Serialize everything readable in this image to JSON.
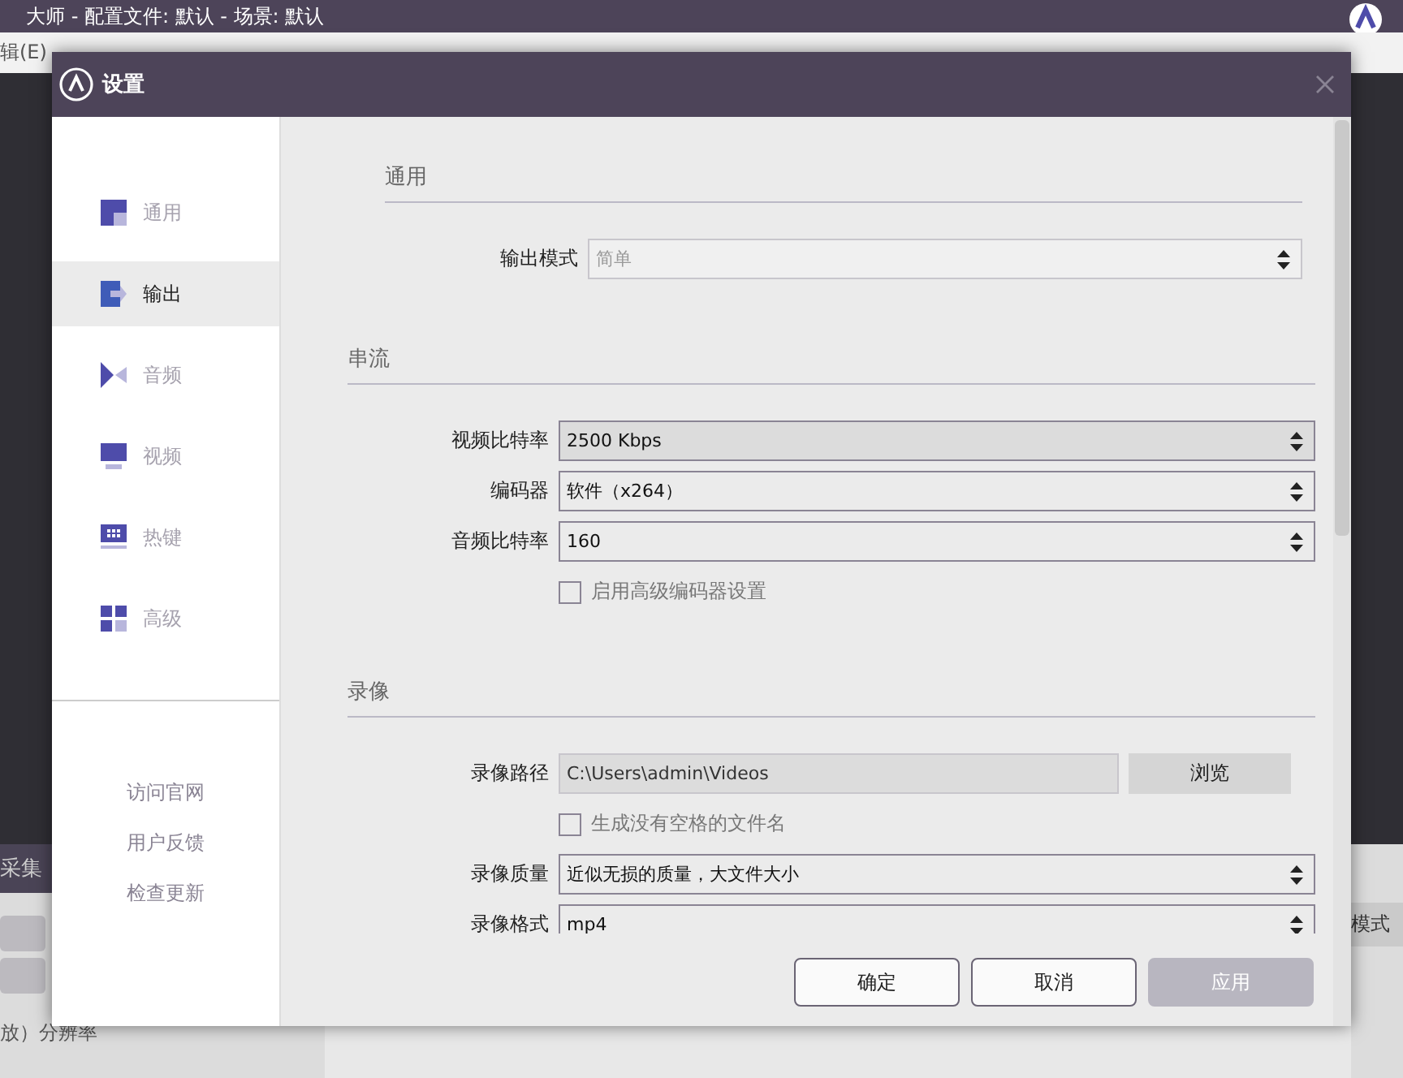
{
  "background_app": {
    "title": "大师  - 配置文件: 默认 - 场景: 默认",
    "menu": [
      "辑(E)"
    ],
    "dock_title": "采集",
    "mode_button": "模式",
    "resolution_label": "放）分辨率"
  },
  "dialog": {
    "title": "设置",
    "sidebar": {
      "items": [
        {
          "label": "通用",
          "selected": false
        },
        {
          "label": "输出",
          "selected": true
        },
        {
          "label": "音频",
          "selected": false
        },
        {
          "label": "视频",
          "selected": false
        },
        {
          "label": "热键",
          "selected": false
        },
        {
          "label": "高级",
          "selected": false
        }
      ],
      "links": [
        "访问官网",
        "用户反馈",
        "检查更新"
      ]
    },
    "sections": [
      {
        "title": "通用",
        "rows": [
          {
            "kind": "select",
            "label": "输出模式",
            "value": "简单",
            "disabled": true
          }
        ]
      },
      {
        "title": "串流",
        "rows": [
          {
            "kind": "spin",
            "label": "视频比特率",
            "value": "2500 Kbps"
          },
          {
            "kind": "select",
            "label": "编码器",
            "value": "软件（x264）",
            "disabled": false
          },
          {
            "kind": "select",
            "label": "音频比特率",
            "value": "160",
            "disabled": false
          },
          {
            "kind": "checkbox",
            "label": "启用高级编码器设置",
            "checked": false
          }
        ]
      },
      {
        "title": "录像",
        "rows": [
          {
            "kind": "path",
            "label": "录像路径",
            "value": "C:\\Users\\admin\\Videos",
            "button": "浏览"
          },
          {
            "kind": "checkbox",
            "label": "生成没有空格的文件名",
            "checked": false
          },
          {
            "kind": "select",
            "label": "录像质量",
            "value": "近似无损的质量，大文件大小",
            "disabled": false
          },
          {
            "kind": "select",
            "label": "录像格式",
            "value": "mp4",
            "disabled": false
          }
        ]
      }
    ],
    "buttons": [
      {
        "label": "确定",
        "disabled": false
      },
      {
        "label": "取消",
        "disabled": false
      },
      {
        "label": "应用",
        "disabled": true
      }
    ]
  }
}
